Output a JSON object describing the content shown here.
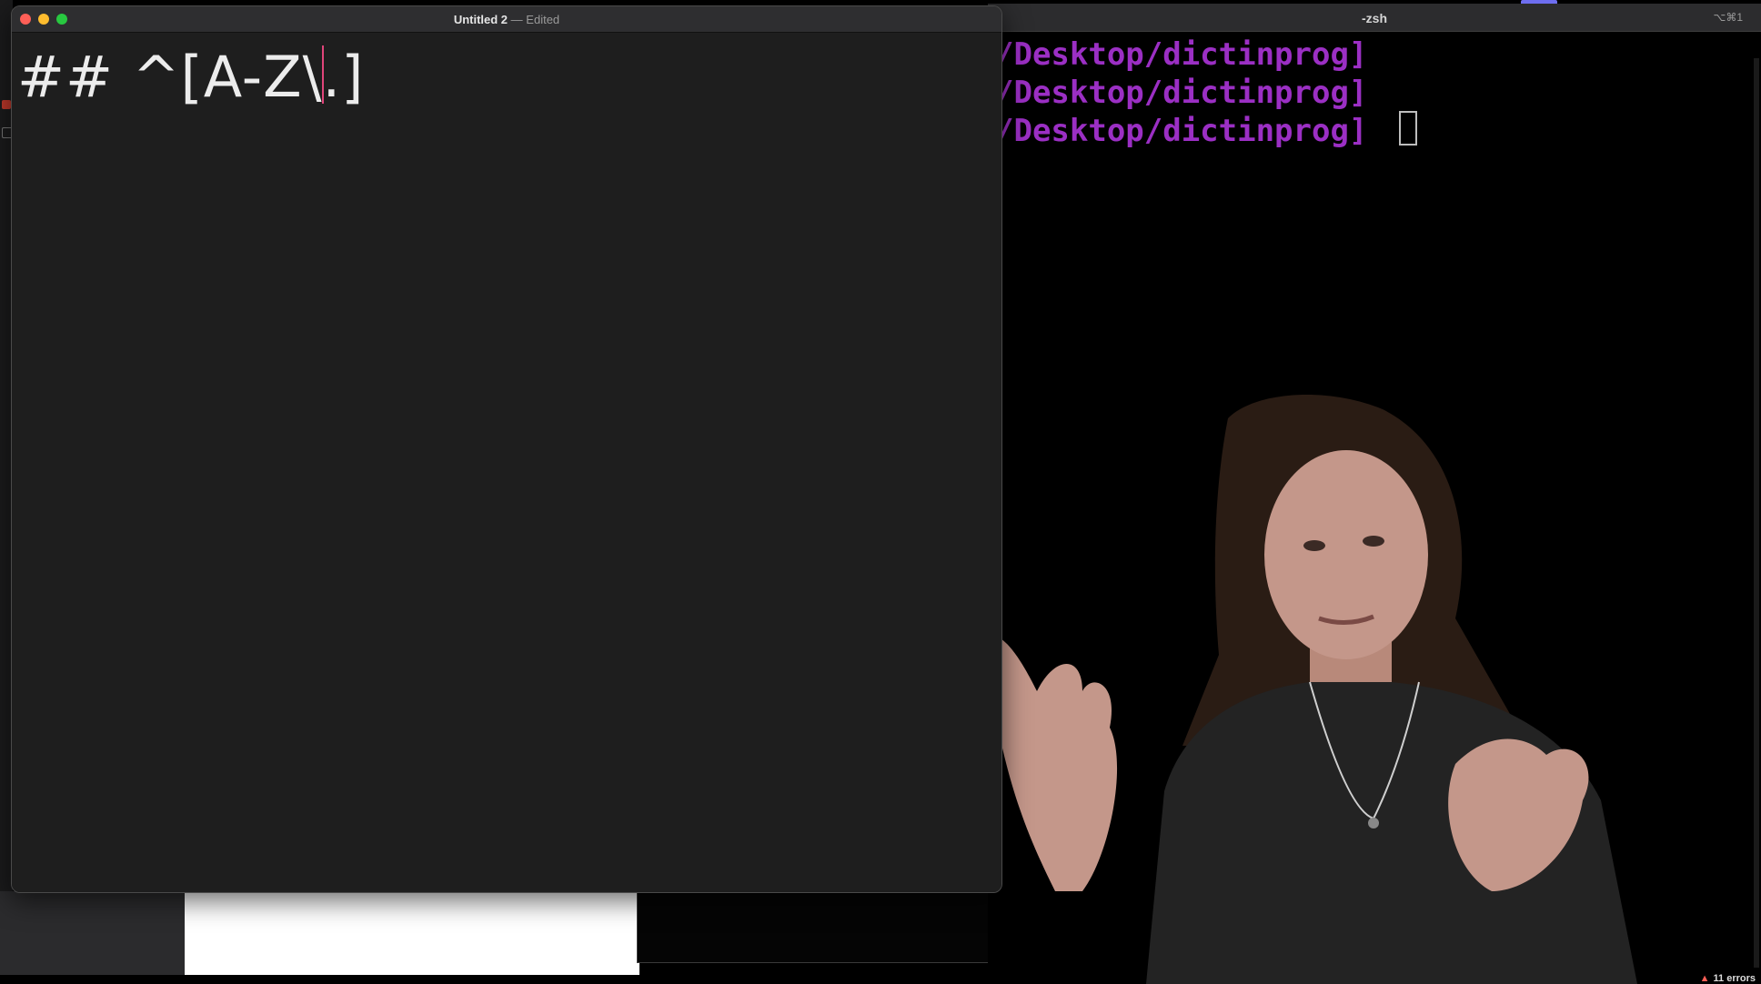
{
  "editor": {
    "title": "Untitled 2",
    "title_separator": "—",
    "status": "Edited",
    "text_before_caret": "## ^[A-Z\\",
    "text_after_caret": ".]"
  },
  "terminal": {
    "title": "-zsh",
    "shortcut": "⌥⌘1",
    "lines": [
      "/Desktop/dictinprog]",
      "/Desktop/dictinprog]",
      "/Desktop/dictinprog]"
    ]
  },
  "statusbar": {
    "errors_label": "11 errors"
  },
  "colors": {
    "prompt_purple": "#9b2fc4",
    "editor_bg": "#1e1e1e",
    "caret_pink": "#e0457a"
  },
  "icons": [
    "close-icon",
    "minimize-icon",
    "maximize-icon",
    "warning-icon"
  ]
}
